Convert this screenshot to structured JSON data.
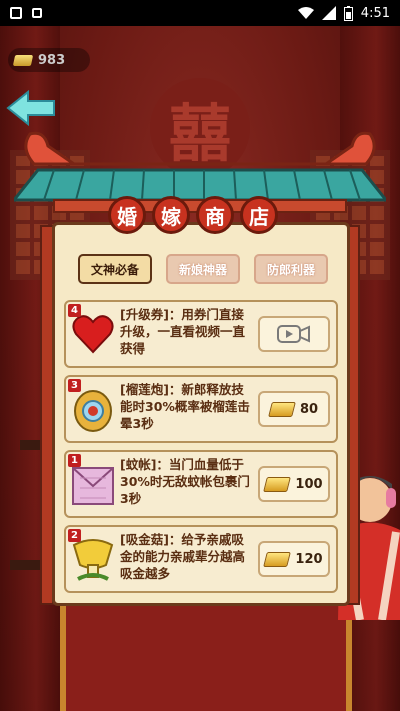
{
  "status_bar": {
    "time": "4:51"
  },
  "currency": {
    "amount": "983"
  },
  "shop": {
    "title_chars": [
      "婚",
      "嫁",
      "商",
      "店"
    ],
    "tabs": [
      {
        "label": "文神必备",
        "active": true
      },
      {
        "label": "新娘神器",
        "active": false
      },
      {
        "label": "防郎利器",
        "active": false
      }
    ],
    "items": [
      {
        "count": "4",
        "icon": "heart-icon",
        "desc": "[升级券]：用券门直接升级，一直看视频一直获得",
        "price_type": "video",
        "price": ""
      },
      {
        "count": "3",
        "icon": "durian-cannon-icon",
        "desc": "[榴莲炮]：新郎释放技能时30%概率被榴莲击晕3秒",
        "price_type": "gold",
        "price": "80"
      },
      {
        "count": "1",
        "icon": "mosquito-net-icon",
        "desc": "[蚊帐]：当门血量低于30%时无敌蚊帐包裹门3秒",
        "price_type": "gold",
        "price": "100"
      },
      {
        "count": "2",
        "icon": "gold-mushroom-icon",
        "desc": "[吸金菇]：给予亲戚吸金的能力亲戚辈分越高吸金越多",
        "price_type": "gold",
        "price": "120"
      }
    ]
  },
  "colors": {
    "roof_teal": "#3aa6a0",
    "roof_red": "#e0523a",
    "panel": "#f6e9c6",
    "badge": "#c11f1f"
  }
}
